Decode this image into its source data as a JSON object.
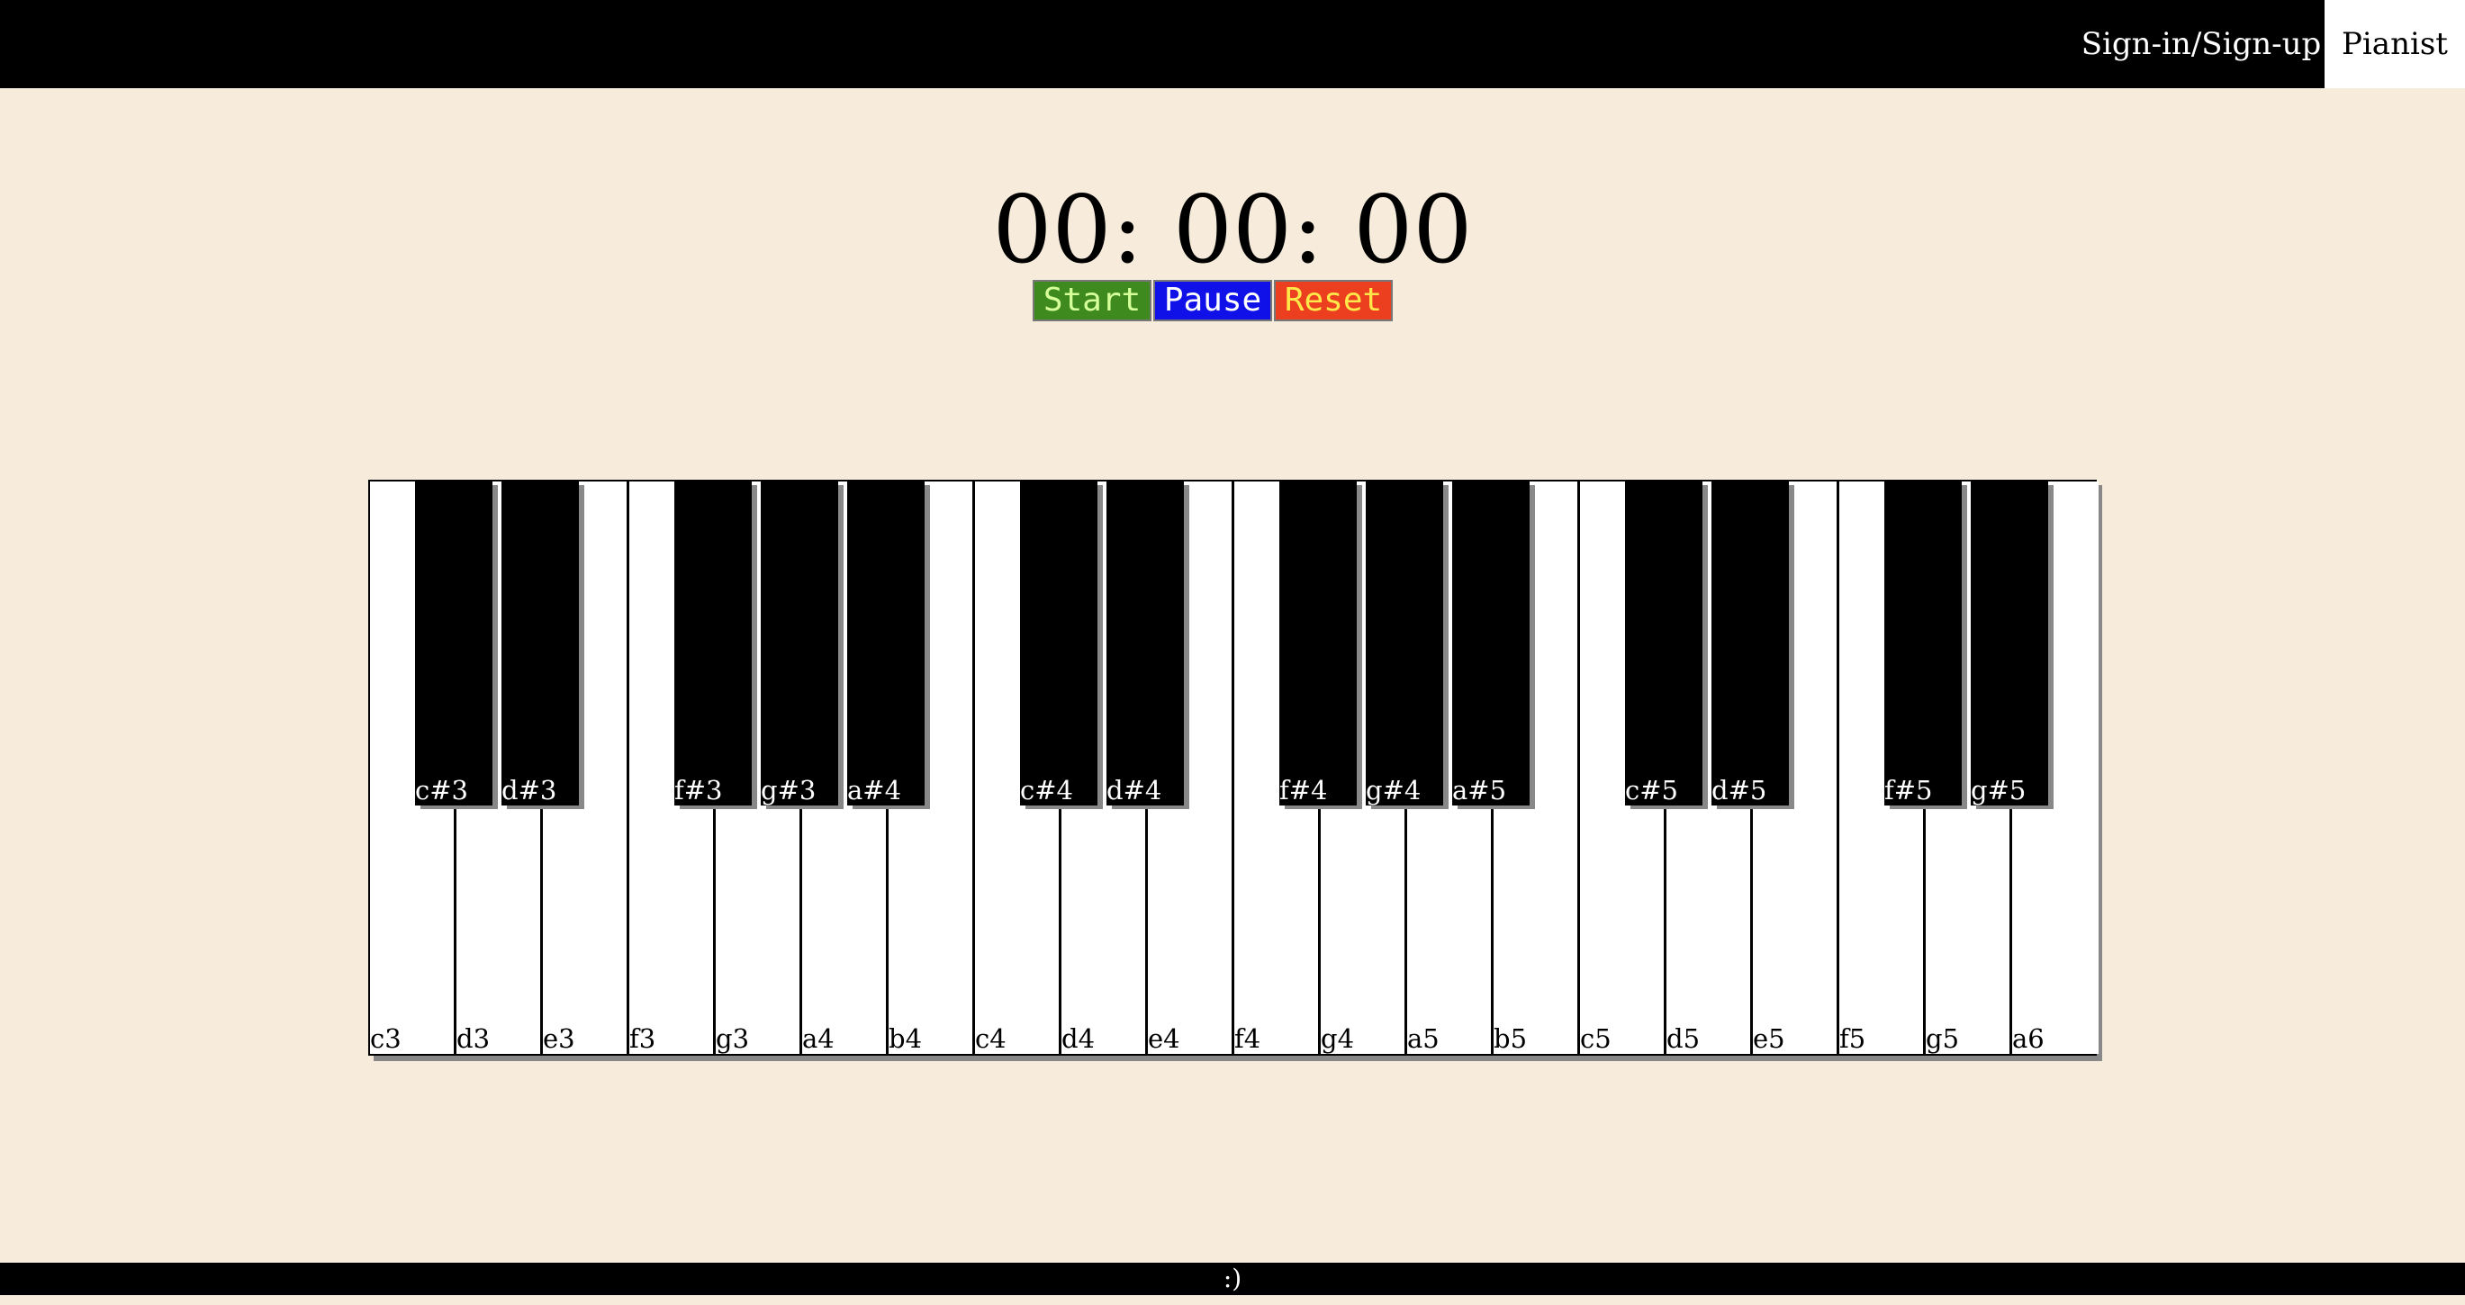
{
  "nav": {
    "signin_label": "Sign-in/Sign-up",
    "brand_label": "Pianist"
  },
  "timer": {
    "display": "00: 00: 00",
    "start_label": "Start",
    "pause_label": "Pause",
    "reset_label": "Reset"
  },
  "piano": {
    "white_keys": [
      "c3",
      "d3",
      "e3",
      "f3",
      "g3",
      "a4",
      "b4",
      "c4",
      "d4",
      "e4",
      "f4",
      "g4",
      "a5",
      "b5",
      "c5",
      "d5",
      "e5",
      "f5",
      "g5",
      "a6"
    ],
    "black_keys": [
      {
        "label": "c#3",
        "after_white": 0
      },
      {
        "label": "d#3",
        "after_white": 1
      },
      {
        "label": "f#3",
        "after_white": 3
      },
      {
        "label": "g#3",
        "after_white": 4
      },
      {
        "label": "a#4",
        "after_white": 5
      },
      {
        "label": "c#4",
        "after_white": 7
      },
      {
        "label": "d#4",
        "after_white": 8
      },
      {
        "label": "f#4",
        "after_white": 10
      },
      {
        "label": "g#4",
        "after_white": 11
      },
      {
        "label": "a#5",
        "after_white": 12
      },
      {
        "label": "c#5",
        "after_white": 14
      },
      {
        "label": "d#5",
        "after_white": 15
      },
      {
        "label": "f#5",
        "after_white": 17
      },
      {
        "label": "g#5",
        "after_white": 18
      }
    ]
  },
  "footer": {
    "text": ":)"
  }
}
